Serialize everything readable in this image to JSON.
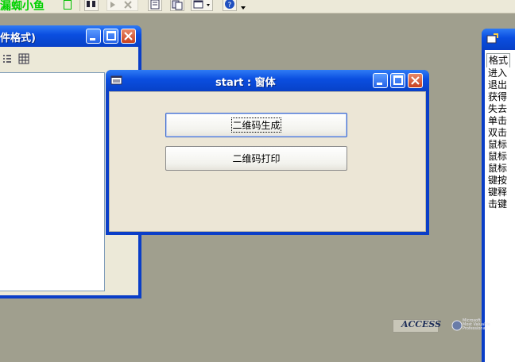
{
  "toolbar": {
    "app_title": "漏蜘小鱼",
    "icons": [
      "binoculars-icon",
      "run-icon",
      "properties-icon",
      "code-icon",
      "window-icon",
      "help-icon",
      "overflow-icon"
    ]
  },
  "left_window": {
    "title": "件格式)"
  },
  "main_window": {
    "title": "start : 窗体",
    "buttons": [
      {
        "label": "二维码生成",
        "focused": true
      },
      {
        "label": "二维码打印",
        "focused": false
      }
    ]
  },
  "property_sheet": {
    "tab": "格式",
    "events": [
      "进入",
      "退出",
      "获得",
      "失去",
      "单击",
      "双击",
      "鼠标",
      "鼠标",
      "鼠标",
      "键按",
      "键释",
      "击键"
    ]
  },
  "logos": {
    "access": "ACCESS",
    "mvp_line1": "Microsoft",
    "mvp_line2": "Most Valuable",
    "mvp_line3": "Professional"
  },
  "colors": {
    "desktop": "#a09f8e",
    "titlebar": "#0a4ee0",
    "close": "#c8401e",
    "form_bg": "#ece6d6"
  }
}
